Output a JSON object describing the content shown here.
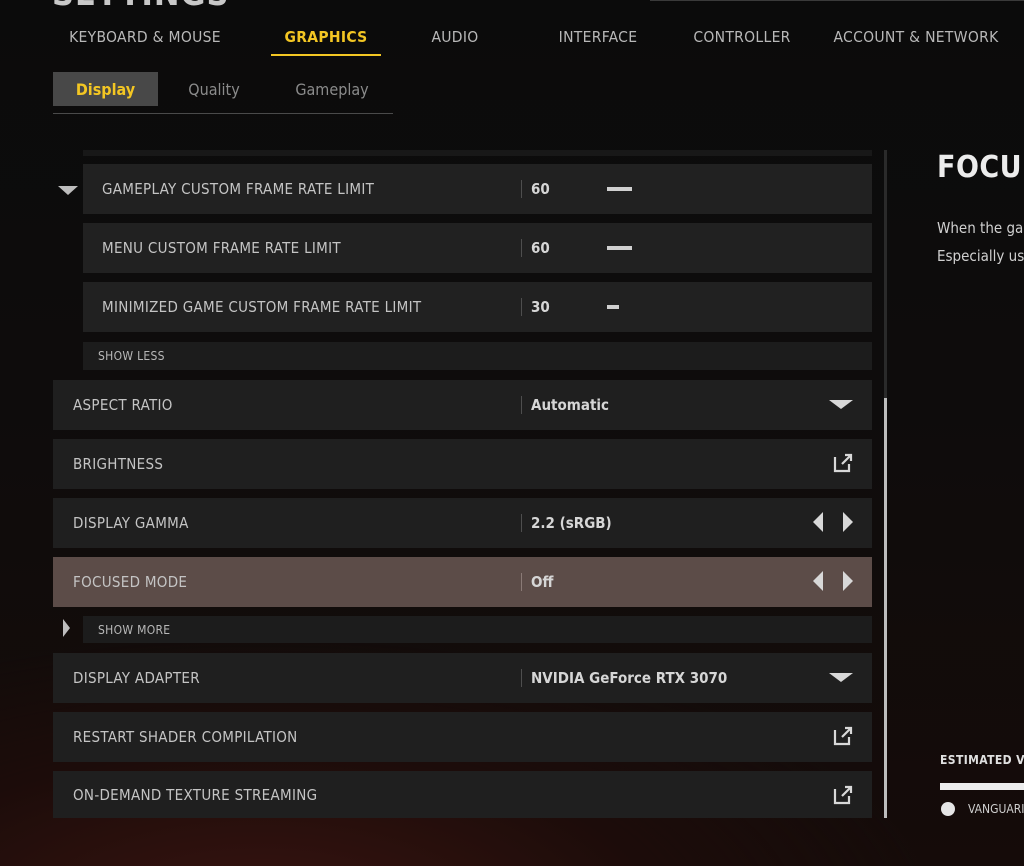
{
  "header": {
    "title": "SETTINGS"
  },
  "main_tabs": [
    {
      "label": "KEYBOARD & MOUSE"
    },
    {
      "label": "GRAPHICS"
    },
    {
      "label": "AUDIO"
    },
    {
      "label": "INTERFACE"
    },
    {
      "label": "CONTROLLER"
    },
    {
      "label": "ACCOUNT & NETWORK"
    }
  ],
  "sub_tabs": [
    {
      "label": "Display"
    },
    {
      "label": "Quality"
    },
    {
      "label": "Gameplay"
    }
  ],
  "settings": {
    "gameplay_frame_limit": {
      "label": "GAMEPLAY CUSTOM FRAME RATE LIMIT",
      "value": "60"
    },
    "menu_frame_limit": {
      "label": "MENU CUSTOM FRAME RATE LIMIT",
      "value": "60"
    },
    "minimized_frame_limit": {
      "label": "MINIMIZED GAME CUSTOM FRAME RATE LIMIT",
      "value": "30"
    },
    "show_less": "SHOW LESS",
    "aspect_ratio": {
      "label": "ASPECT RATIO",
      "value": "Automatic"
    },
    "brightness": {
      "label": "BRIGHTNESS"
    },
    "display_gamma": {
      "label": "DISPLAY GAMMA",
      "value": "2.2 (sRGB)"
    },
    "focused_mode": {
      "label": "FOCUSED MODE",
      "value": "Off"
    },
    "show_more": "SHOW MORE",
    "display_adapter": {
      "label": "DISPLAY ADAPTER",
      "value": "NVIDIA GeForce RTX 3070"
    },
    "restart_shader": {
      "label": "RESTART SHADER COMPILATION"
    },
    "texture_streaming": {
      "label": "ON-DEMAND TEXTURE STREAMING"
    }
  },
  "detail": {
    "title": "FOCUS",
    "desc_line1": "When the ga",
    "desc_line2": "Especially us",
    "vram_label": "ESTIMATED VR",
    "vram_legend": "VANGUARI"
  },
  "colors": {
    "accent": "#f3c623",
    "selected_row": "#5c4c48",
    "row_bg": "#1f1f1f"
  }
}
